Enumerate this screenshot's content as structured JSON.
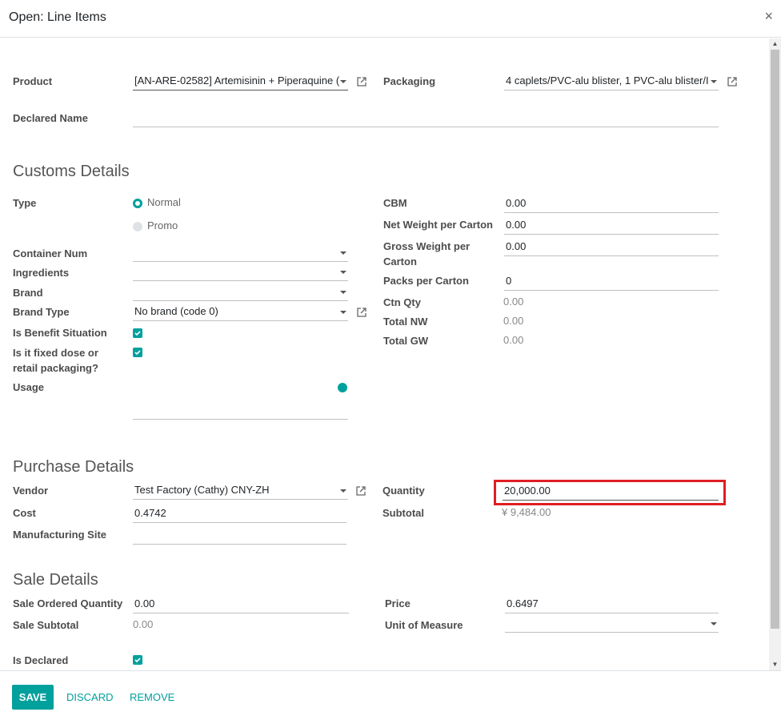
{
  "dialog": {
    "title": "Open: Line Items",
    "close_symbol": "×"
  },
  "top": {
    "product_label": "Product",
    "product_value": "[AN-ARE-02582] Artemisinin + Piperaquine (",
    "packaging_label": "Packaging",
    "packaging_value": "4 caplets/PVC-alu blister, 1 PVC-alu blister/I",
    "declared_name_label": "Declared Name",
    "declared_name_value": ""
  },
  "customs": {
    "title": "Customs Details",
    "type_label": "Type",
    "type_options": [
      {
        "label": "Normal",
        "checked": true
      },
      {
        "label": "Promo",
        "checked": false
      }
    ],
    "container_num_label": "Container Num",
    "ingredients_label": "Ingredients",
    "brand_label": "Brand",
    "brand_type_label": "Brand Type",
    "brand_type_value": "No brand (code 0)",
    "benefit_label": "Is Benefit Situation",
    "fixed_dose_label": "Is it fixed dose or retail packaging?",
    "usage_label": "Usage",
    "cbm_label": "CBM",
    "cbm_value": "0.00",
    "net_weight_label": "Net Weight per Carton",
    "net_weight_value": "0.00",
    "gross_weight_label": "Gross Weight per Carton",
    "gross_weight_value": "0.00",
    "packs_label": "Packs per Carton",
    "packs_value": "0",
    "ctn_qty_label": "Ctn Qty",
    "ctn_qty_value": "0.00",
    "total_nw_label": "Total NW",
    "total_nw_value": "0.00",
    "total_gw_label": "Total GW",
    "total_gw_value": "0.00"
  },
  "purchase": {
    "title": "Purchase Details",
    "vendor_label": "Vendor",
    "vendor_value": "Test Factory (Cathy) CNY-ZH",
    "cost_label": "Cost",
    "cost_value": "0.4742",
    "site_label": "Manufacturing Site",
    "quantity_label": "Quantity",
    "quantity_value": "20,000.00",
    "subtotal_label": "Subtotal",
    "subtotal_value": "¥ 9,484.00"
  },
  "sale": {
    "title": "Sale Details",
    "ordered_qty_label": "Sale Ordered Quantity",
    "ordered_qty_value": "0.00",
    "subtotal_label": "Sale Subtotal",
    "subtotal_value": "0.00",
    "price_label": "Price",
    "price_value": "0.6497",
    "uom_label": "Unit of Measure",
    "declared_label": "Is Declared"
  },
  "footer": {
    "save": "SAVE",
    "discard": "DISCARD",
    "remove": "REMOVE"
  },
  "colors": {
    "accent": "#00a09d",
    "highlight": "#e01e24"
  }
}
